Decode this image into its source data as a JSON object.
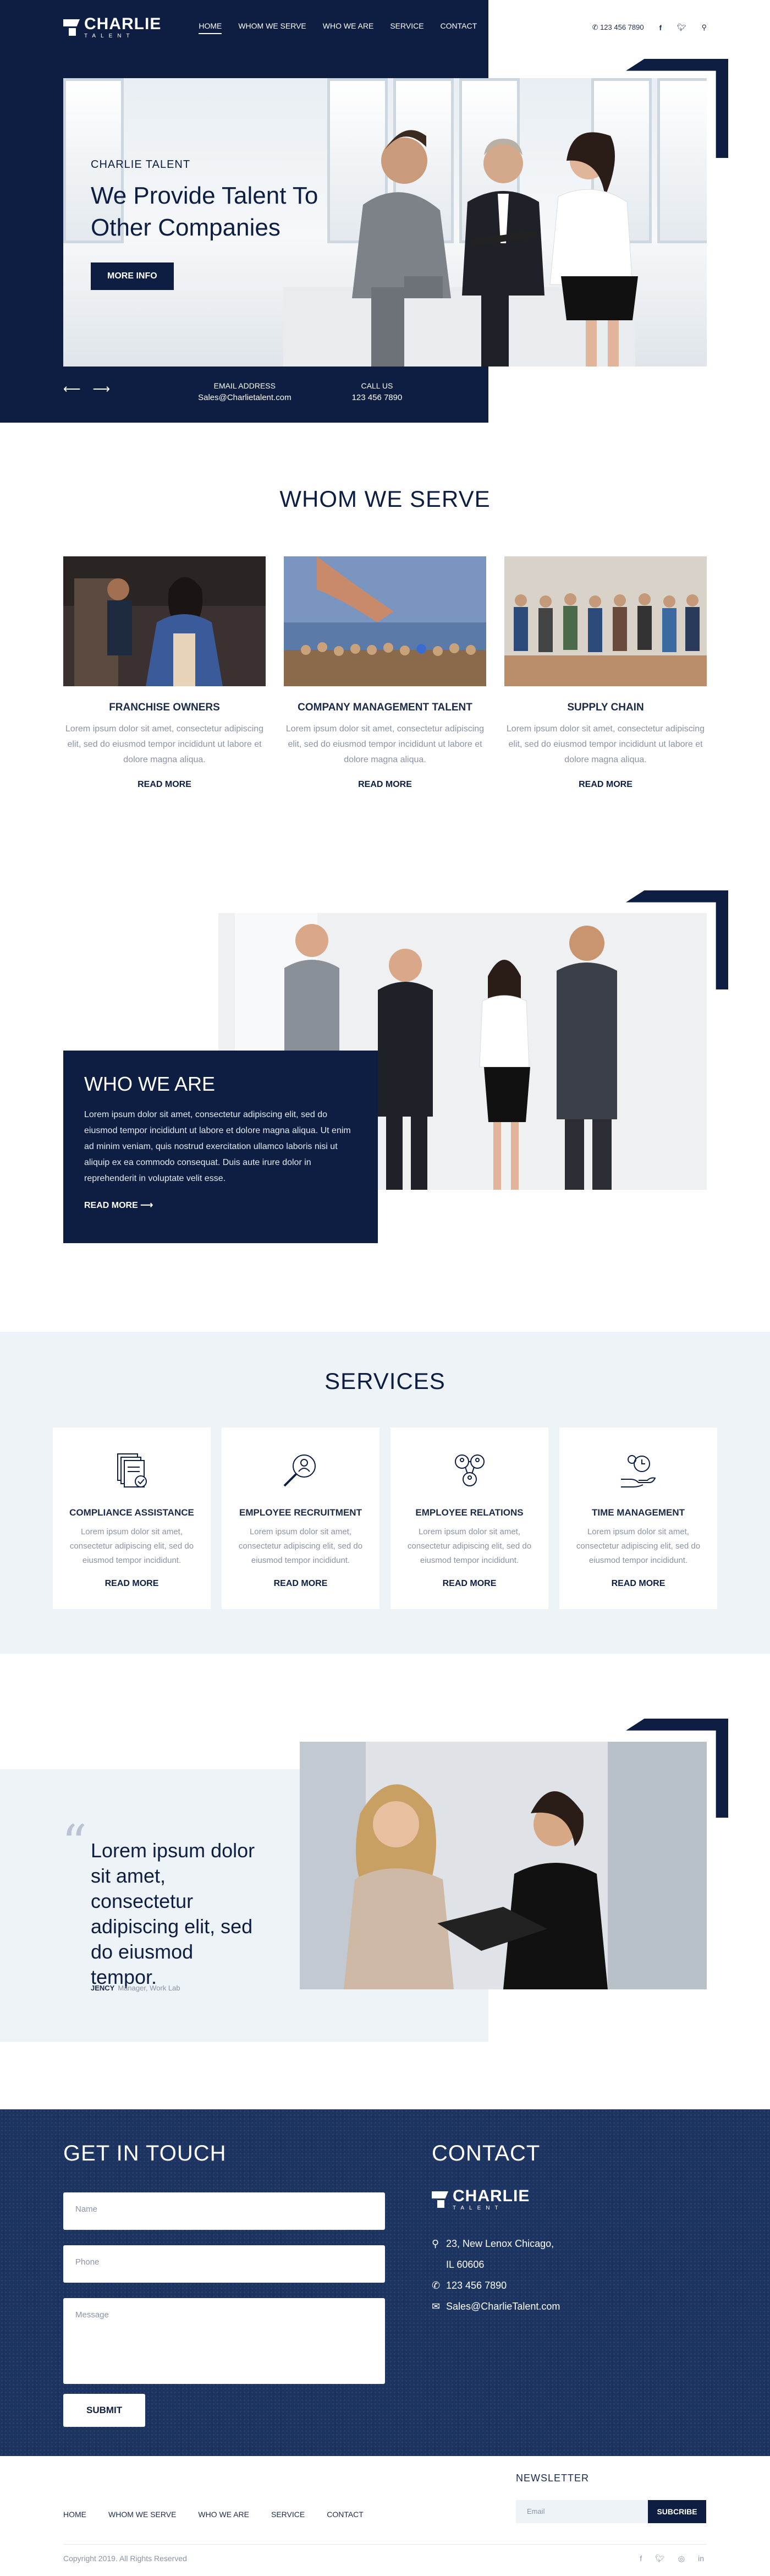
{
  "brand": {
    "name": "CHARLIE",
    "sub": "TALENT"
  },
  "nav": {
    "items": [
      "HOME",
      "WHOM WE SERVE",
      "WHO WE ARE",
      "SERVICE",
      "CONTACT"
    ],
    "active": "HOME"
  },
  "topbar": {
    "phone": "123 456 7890",
    "icons": [
      "phone-icon",
      "facebook-icon",
      "twitter-icon",
      "search-icon"
    ]
  },
  "hero": {
    "kicker": "CHARLIE TALENT",
    "title": "We Provide Talent To Other Companies",
    "button": "MORE INFO",
    "email_label": "EMAIL ADDRESS",
    "email": "Sales@Charlietalent.com",
    "call_label": "CALL US",
    "phone": "123 456 7890"
  },
  "whom": {
    "title": "WHOM WE SERVE",
    "cards": [
      {
        "title": "FRANCHISE OWNERS",
        "text": "Lorem ipsum dolor sit amet, consectetur adipiscing elit, sed do eiusmod tempor incididunt ut labore et dolore magna aliqua.",
        "link": "READ MORE"
      },
      {
        "title": "COMPANY MANAGEMENT TALENT",
        "text": "Lorem ipsum dolor sit amet, consectetur adipiscing elit, sed do eiusmod tempor incididunt ut labore et dolore magna aliqua.",
        "link": "READ MORE"
      },
      {
        "title": "SUPPLY CHAIN",
        "text": "Lorem ipsum dolor sit amet, consectetur adipiscing elit, sed do eiusmod tempor incididunt ut labore et dolore magna aliqua.",
        "link": "READ MORE"
      }
    ]
  },
  "who": {
    "title": "WHO WE ARE",
    "text": "Lorem ipsum dolor sit amet, consectetur adipiscing elit, sed do eiusmod tempor incididunt ut labore et dolore magna aliqua. Ut enim ad minim veniam, quis nostrud exercitation ullamco laboris nisi ut aliquip ex ea commodo consequat. Duis aute irure dolor in reprehenderit in voluptate velit esse.",
    "link": "READ MORE ⟶"
  },
  "services": {
    "title": "SERVICES",
    "cards": [
      {
        "title": "COMPLIANCE ASSISTANCE",
        "text": "Lorem ipsum dolor sit amet, consectetur adipiscing elit, sed do eiusmod tempor incididunt.",
        "link": "READ MORE",
        "icon": "documents-icon"
      },
      {
        "title": "EMPLOYEE RECRUITMENT",
        "text": "Lorem ipsum dolor sit amet, consectetur adipiscing elit, sed do eiusmod tempor incididunt.",
        "link": "READ MORE",
        "icon": "magnifier-person-icon"
      },
      {
        "title": "EMPLOYEE RELATIONS",
        "text": "Lorem ipsum dolor sit amet, consectetur adipiscing elit, sed do eiusmod tempor incididunt.",
        "link": "READ MORE",
        "icon": "people-network-icon"
      },
      {
        "title": "TIME MANAGEMENT",
        "text": "Lorem ipsum dolor sit amet, consectetur adipiscing elit, sed do eiusmod tempor incididunt.",
        "link": "READ MORE",
        "icon": "hand-clock-icon"
      }
    ]
  },
  "testimonial": {
    "quote": "Lorem ipsum dolor sit amet, consectetur adipiscing elit, sed do eiusmod tempor.",
    "name": "JENCY",
    "role": "Manager, Work Lab"
  },
  "contact": {
    "left_title": "GET IN TOUCH",
    "name_ph": "Name",
    "phone_ph": "Phone",
    "message_ph": "Message",
    "submit": "SUBMIT",
    "right_title": "CONTACT",
    "address1": "23, New Lenox Chicago,",
    "address2": "IL 60606",
    "phone": "123 456 7890",
    "email": "Sales@CharlieTalent.com"
  },
  "footer": {
    "newsletter": "NEWSLETTER",
    "email_ph": "Email",
    "subscribe": "SUBCRIBE",
    "nav": [
      "HOME",
      "WHOM WE SERVE",
      "WHO WE ARE",
      "SERVICE",
      "CONTACT"
    ],
    "copyright": "Copyright 2019. All Rights Reserved"
  },
  "colors": {
    "navy": "#0d1e42",
    "contact_bg": "#1d3461",
    "light_bg": "#eef3f8"
  }
}
